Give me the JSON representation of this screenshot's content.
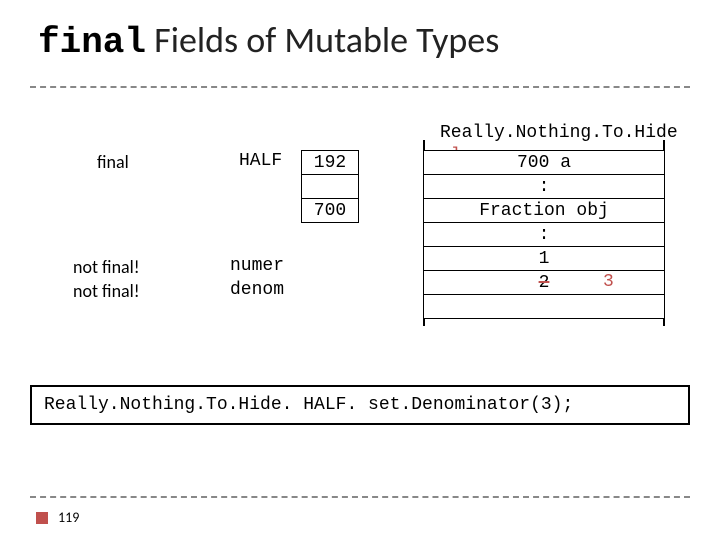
{
  "title": {
    "keyword": "final",
    "rest": " Fields of Mutable Types"
  },
  "classLabel": {
    "name": "Really.Nothing.To.Hide",
    "keyword": "class"
  },
  "labels": {
    "final": "final",
    "notFinal1": "not final!",
    "notFinal2": "not final!",
    "half": "HALF",
    "numer": "numer",
    "denom": "denom"
  },
  "stack": {
    "halfAddr": "192",
    "blank": "",
    "objAddr": "700"
  },
  "object": {
    "addr": "700 a",
    "colon1": ":",
    "type": "Fraction obj",
    "colon2": ":",
    "numer": "1",
    "denom": "2",
    "empty": ""
  },
  "newDenom": "3",
  "code": "Really.Nothing.To.Hide. HALF. set.Denominator(3);",
  "pageNum": "119"
}
